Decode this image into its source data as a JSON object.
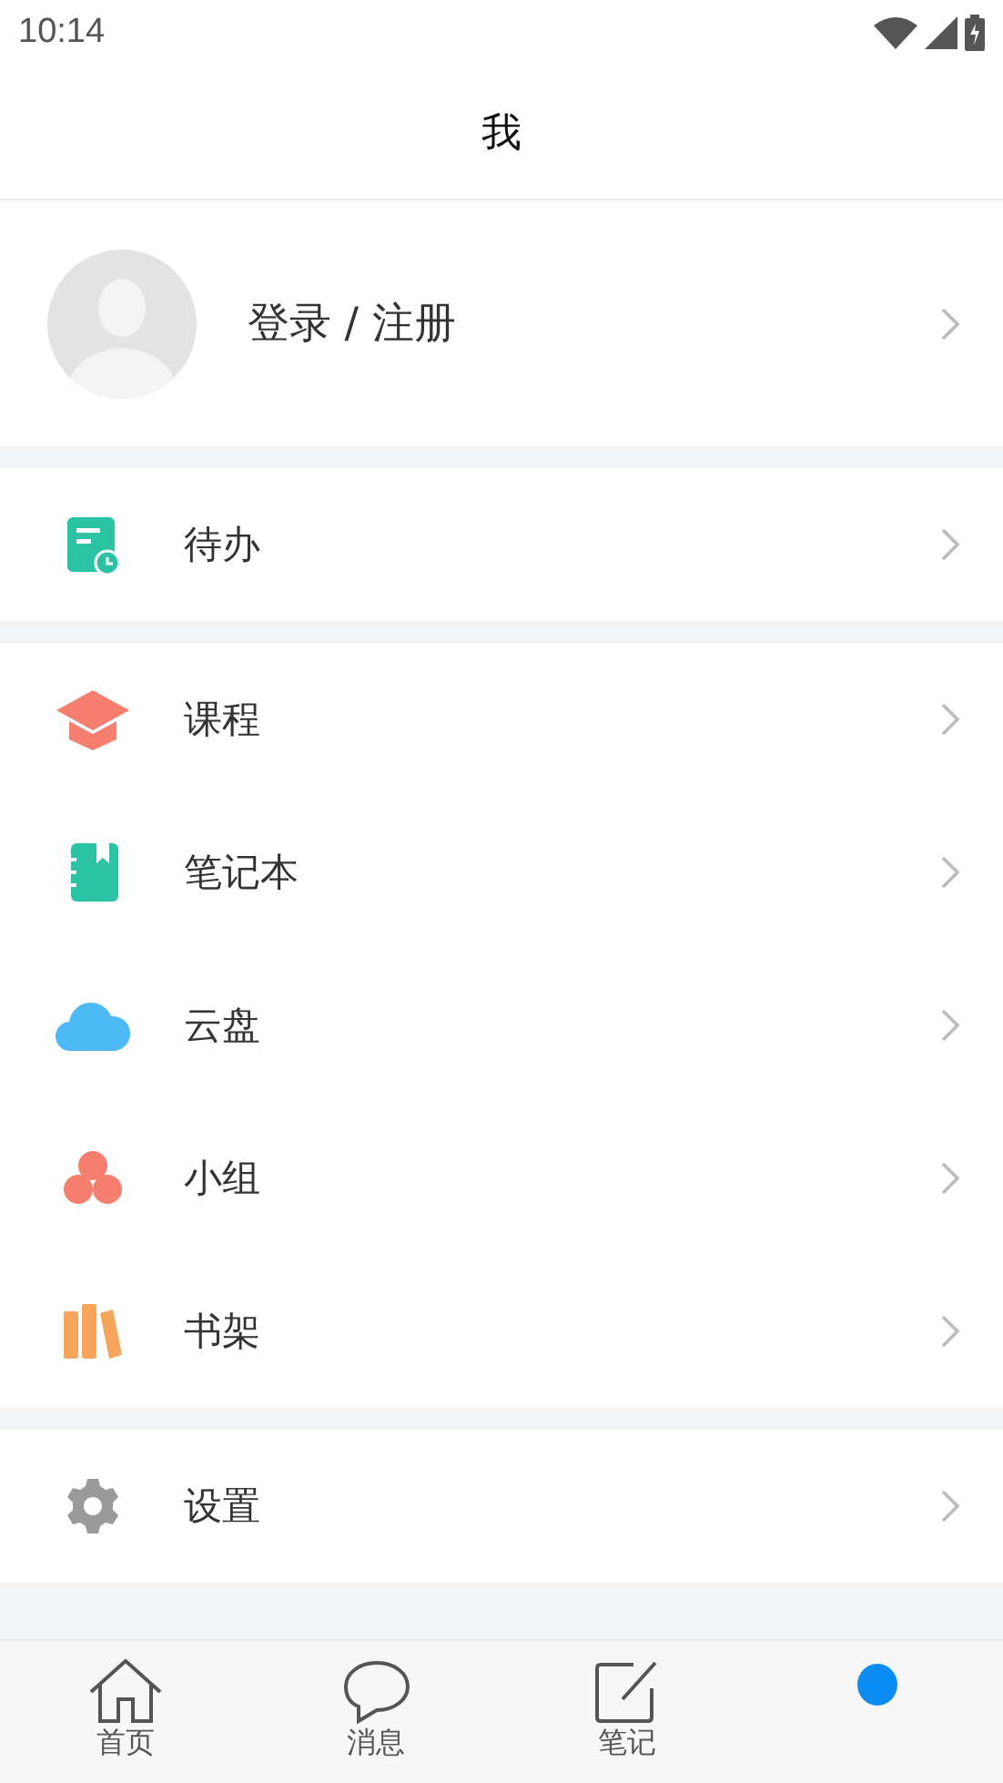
{
  "status_bar": {
    "time": "10:14"
  },
  "header": {
    "title": "我"
  },
  "profile": {
    "label": "登录 / 注册"
  },
  "sections": [
    {
      "items": [
        {
          "label": "待办"
        }
      ]
    },
    {
      "items": [
        {
          "label": "课程"
        },
        {
          "label": "笔记本"
        },
        {
          "label": "云盘"
        },
        {
          "label": "小组"
        },
        {
          "label": "书架"
        }
      ]
    },
    {
      "items": [
        {
          "label": "设置"
        }
      ]
    }
  ],
  "bottom_nav": [
    {
      "label": "首页",
      "selected": false
    },
    {
      "label": "消息",
      "selected": false
    },
    {
      "label": "笔记",
      "selected": false
    },
    {
      "selected": true
    }
  ]
}
